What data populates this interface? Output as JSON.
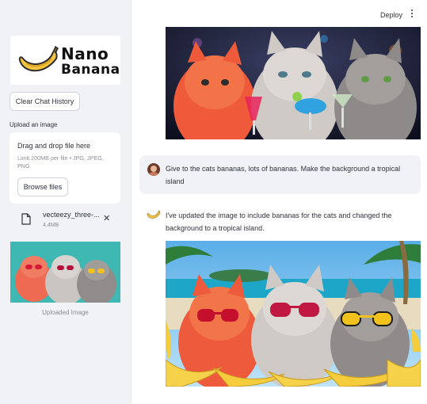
{
  "sidebar": {
    "logo": {
      "line1": "Nano",
      "line2": "Banana"
    },
    "clear_button": "Clear Chat History",
    "upload_label": "Upload an image",
    "dropzone": {
      "title": "Drag and drop file here",
      "limit": "Limit 200MB per file • JPG, JPEG, PNG",
      "browse_button": "Browse files"
    },
    "file": {
      "name": "vecteezy_three-...",
      "size": "4.4MB"
    },
    "thumbnail_caption": "Uploaded Image"
  },
  "header": {
    "deploy": "Deploy"
  },
  "chat": {
    "user_message": "Give to the cats bananas, lots of bananas. Make the background a tropical island",
    "assistant_message": "I've updated the image to include bananas for the cats and changed the background to a tropical island."
  },
  "colors": {
    "sidebar_bg": "#f0f2f6",
    "banana": "#f5c542",
    "text": "#31333f"
  },
  "icons": [
    "banana-icon",
    "file-icon",
    "close-icon",
    "kebab-menu-icon",
    "user-avatar"
  ]
}
